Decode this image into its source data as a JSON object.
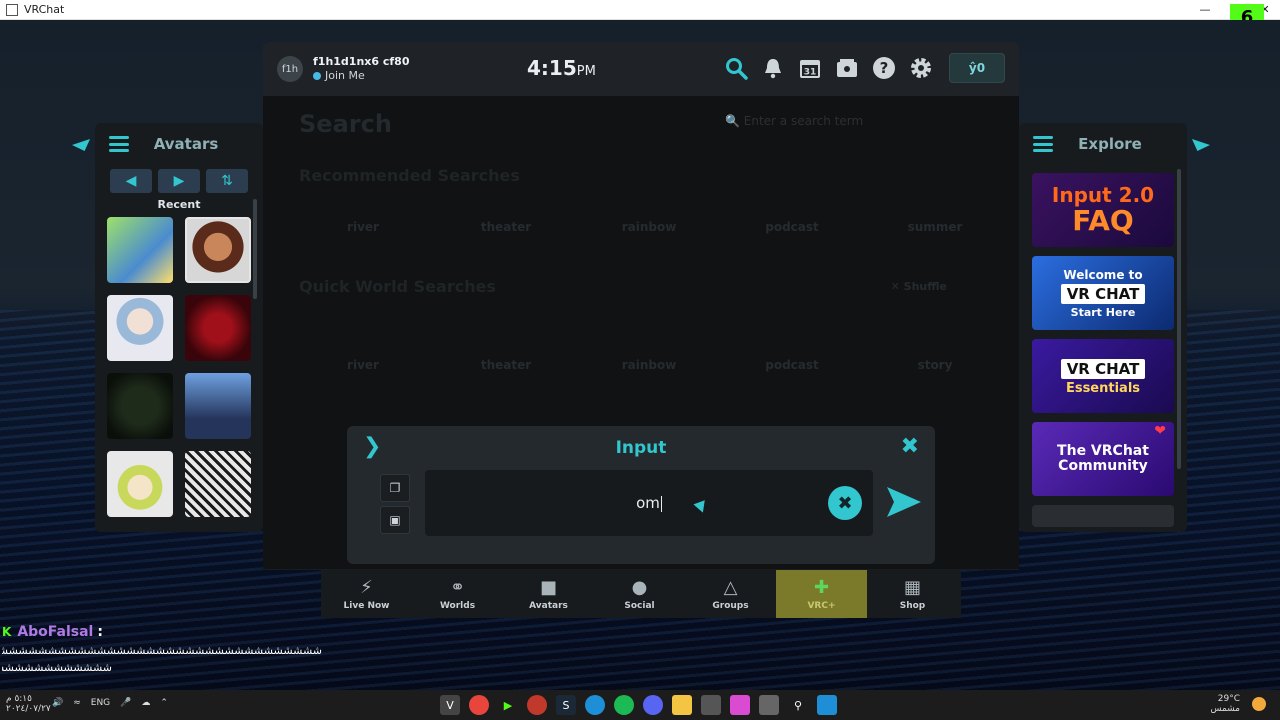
{
  "window": {
    "title": "VRChat",
    "kick_badge": "6"
  },
  "topbar": {
    "avatar_initials": "f1h",
    "username": "f1h1d1nx6 cf80",
    "status": "Join Me",
    "time": "4:15",
    "ampm": "PM",
    "currency": "ŷ0",
    "icons": [
      "search-icon",
      "bell-icon",
      "calendar-icon",
      "gallery-icon",
      "help-icon",
      "gear-icon"
    ],
    "calendar_day": "31"
  },
  "search": {
    "title": "Search",
    "placeholder": "Enter a search term",
    "recommended_title": "Recommended Searches",
    "recommended": [
      "river",
      "theater",
      "rainbow",
      "podcast",
      "summer"
    ],
    "quick_title": "Quick World Searches",
    "shuffle_label": "Shuffle",
    "quick": [
      "river",
      "theater",
      "rainbow",
      "podcast",
      "story"
    ]
  },
  "avatars_panel": {
    "title": "Avatars",
    "section": "Recent"
  },
  "explore_panel": {
    "title": "Explore",
    "cards": [
      {
        "line1": "Input 2.0",
        "line2": "FAQ"
      },
      {
        "line1": "Welcome to",
        "line2": "VR CHAT",
        "line3": "Start Here"
      },
      {
        "line1": "VR CHAT",
        "line2": "Essentials"
      },
      {
        "line1": "The VRChat",
        "line2": "Community"
      }
    ]
  },
  "input_dialog": {
    "title": "Input",
    "value": "om"
  },
  "bottom_nav": [
    {
      "label": "Live Now",
      "icon": "lightning-icon"
    },
    {
      "label": "Worlds",
      "icon": "planet-icon"
    },
    {
      "label": "Avatars",
      "icon": "avatar-book-icon"
    },
    {
      "label": "Social",
      "icon": "people-icon"
    },
    {
      "label": "Groups",
      "icon": "groups-icon"
    },
    {
      "label": "VRC+",
      "icon": "vrcplus-icon",
      "active": true
    },
    {
      "label": "Shop",
      "icon": "shop-icon"
    }
  ],
  "chat": {
    "name": "AboFalsal",
    "line1": "ششششششششششششششششششششششششششششششششششششششششششششششششششششش",
    "line2": "شششششششششششششششششش"
  },
  "taskbar": {
    "clock": "٥:١٥ م",
    "date": "٢٠٢٤/٠٧/٢٧",
    "lang": "ENG",
    "weather_temp": "29°C",
    "weather_text": "مشمس"
  }
}
